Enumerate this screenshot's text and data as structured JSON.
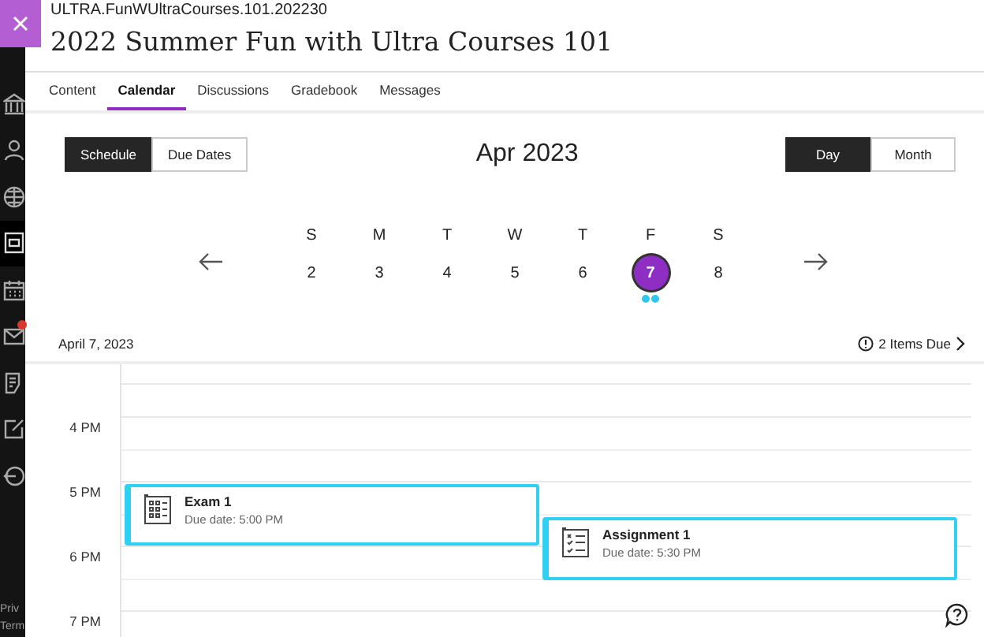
{
  "sidebar": {
    "items": [
      {
        "selected": false,
        "notification": false
      },
      {
        "selected": false,
        "notification": false
      },
      {
        "selected": false,
        "notification": false
      },
      {
        "selected": true,
        "notification": false
      },
      {
        "selected": false,
        "notification": false
      },
      {
        "selected": false,
        "notification": true
      },
      {
        "selected": false,
        "notification": false
      },
      {
        "selected": false,
        "notification": false
      },
      {
        "selected": false,
        "notification": false
      }
    ],
    "footer_links": [
      "Priv",
      "Term"
    ]
  },
  "header": {
    "course_id": "ULTRA.FunWUltraCourses.101.202230",
    "title": "2022 Summer Fun with Ultra Courses 101"
  },
  "tabs": [
    {
      "label": "Content",
      "selected": false
    },
    {
      "label": "Calendar",
      "selected": true
    },
    {
      "label": "Discussions",
      "selected": false
    },
    {
      "label": "Gradebook",
      "selected": false
    },
    {
      "label": "Messages",
      "selected": false
    }
  ],
  "view_toggle": [
    {
      "label": "Schedule",
      "selected": true
    },
    {
      "label": "Due Dates",
      "selected": false
    }
  ],
  "month": "Apr 2023",
  "range_toggle": [
    {
      "label": "Day",
      "selected": true
    },
    {
      "label": "Month",
      "selected": false
    }
  ],
  "week": [
    {
      "weekday": "S",
      "day": "2",
      "selected": false,
      "has_due": false
    },
    {
      "weekday": "M",
      "day": "3",
      "selected": false,
      "has_due": false
    },
    {
      "weekday": "T",
      "day": "4",
      "selected": false,
      "has_due": false
    },
    {
      "weekday": "W",
      "day": "5",
      "selected": false,
      "has_due": false
    },
    {
      "weekday": "T",
      "day": "6",
      "selected": false,
      "has_due": false
    },
    {
      "weekday": "F",
      "day": "7",
      "selected": true,
      "has_due": true
    },
    {
      "weekday": "S",
      "day": "8",
      "selected": false,
      "has_due": false
    }
  ],
  "date_label": "April 7, 2023",
  "items_due": "2 Items Due",
  "hours": [
    "4 PM",
    "5 PM",
    "6 PM",
    "7 PM"
  ],
  "events": [
    {
      "kind": "test",
      "title": "Exam 1",
      "due": "Due date: 5:00 PM"
    },
    {
      "kind": "assignment",
      "title": "Assignment 1",
      "due": "Due date: 5:30 PM"
    }
  ]
}
